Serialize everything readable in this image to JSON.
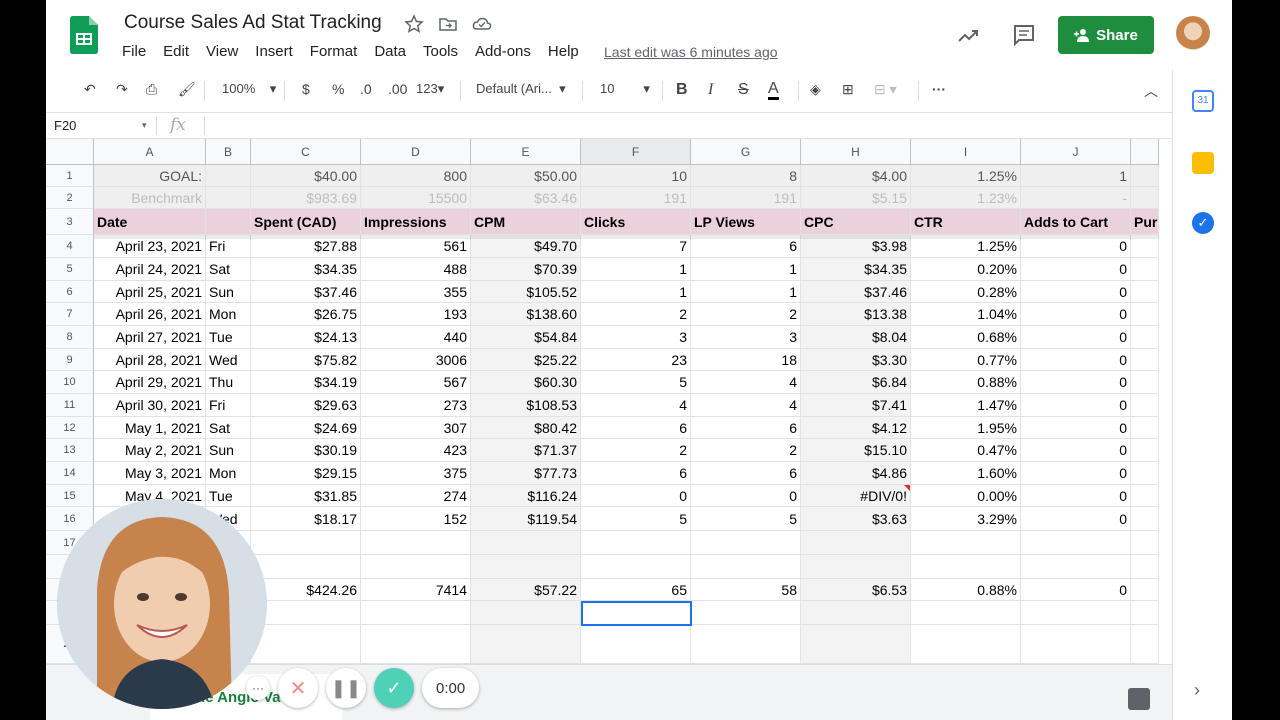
{
  "doc": {
    "title": "Course Sales Ad Stat Tracking",
    "last_edit": "Last edit was 6 minutes ago"
  },
  "menu": [
    "File",
    "Edit",
    "View",
    "Insert",
    "Format",
    "Data",
    "Tools",
    "Add-ons",
    "Help"
  ],
  "share": {
    "label": "Share"
  },
  "toolbar": {
    "zoom": "100%",
    "currency": "$",
    "percent": "%",
    "dec_decrease": ".0",
    "dec_increase": ".00",
    "more_formats": "123",
    "font": "Default (Ari...",
    "font_size": "10",
    "bold": "B",
    "italic": "I",
    "strike": "S",
    "textcolor": "A"
  },
  "formula": {
    "name_box": "F20",
    "fx": "fx"
  },
  "columns": [
    "A",
    "B",
    "C",
    "D",
    "E",
    "F",
    "G",
    "H",
    "I",
    "J"
  ],
  "rows": {
    "r1": [
      "GOAL:",
      "",
      "$40.00",
      "800",
      "$50.00",
      "10",
      "8",
      "$4.00",
      "1.25%",
      "1"
    ],
    "r2": [
      "Benchmark",
      "",
      "$983.69",
      "15500",
      "$63.46",
      "191",
      "191",
      "$5.15",
      "1.23%",
      "-"
    ],
    "r3": [
      "Date",
      "",
      "Spent (CAD)",
      "Impressions",
      "CPM",
      "Clicks",
      "LP Views",
      "CPC",
      "CTR",
      "Adds to Cart",
      "Pur"
    ],
    "data": [
      [
        "April 23, 2021",
        "Fri",
        "$27.88",
        "561",
        "$49.70",
        "7",
        "6",
        "$3.98",
        "1.25%",
        "0"
      ],
      [
        "April 24, 2021",
        "Sat",
        "$34.35",
        "488",
        "$70.39",
        "1",
        "1",
        "$34.35",
        "0.20%",
        "0"
      ],
      [
        "April 25, 2021",
        "Sun",
        "$37.46",
        "355",
        "$105.52",
        "1",
        "1",
        "$37.46",
        "0.28%",
        "0"
      ],
      [
        "April 26, 2021",
        "Mon",
        "$26.75",
        "193",
        "$138.60",
        "2",
        "2",
        "$13.38",
        "1.04%",
        "0"
      ],
      [
        "April 27, 2021",
        "Tue",
        "$24.13",
        "440",
        "$54.84",
        "3",
        "3",
        "$8.04",
        "0.68%",
        "0"
      ],
      [
        "April 28, 2021",
        "Wed",
        "$75.82",
        "3006",
        "$25.22",
        "23",
        "18",
        "$3.30",
        "0.77%",
        "0"
      ],
      [
        "April 29, 2021",
        "Thu",
        "$34.19",
        "567",
        "$60.30",
        "5",
        "4",
        "$6.84",
        "0.88%",
        "0"
      ],
      [
        "April 30, 2021",
        "Fri",
        "$29.63",
        "273",
        "$108.53",
        "4",
        "4",
        "$7.41",
        "1.47%",
        "0"
      ],
      [
        "May 1, 2021",
        "Sat",
        "$24.69",
        "307",
        "$80.42",
        "6",
        "6",
        "$4.12",
        "1.95%",
        "0"
      ],
      [
        "May 2, 2021",
        "Sun",
        "$30.19",
        "423",
        "$71.37",
        "2",
        "2",
        "$15.10",
        "0.47%",
        "0"
      ],
      [
        "May 3, 2021",
        "Mon",
        "$29.15",
        "375",
        "$77.73",
        "6",
        "6",
        "$4.86",
        "1.60%",
        "0"
      ],
      [
        "May 4, 2021",
        "Tue",
        "$31.85",
        "274",
        "$116.24",
        "0",
        "0",
        "#DIV/0!",
        "0.00%",
        "0"
      ],
      [
        "",
        "Wed",
        "$18.17",
        "152",
        "$119.54",
        "5",
        "5",
        "$3.63",
        "3.29%",
        "0"
      ]
    ],
    "totals": [
      "",
      "",
      "$424.26",
      "7414",
      "$57.22",
      "65",
      "58",
      "$6.53",
      "0.88%",
      "0"
    ]
  },
  "row_numbers": [
    "1",
    "2",
    "3",
    "4",
    "5",
    "6",
    "7",
    "8",
    "9",
    "10",
    "11",
    "12",
    "13",
    "14",
    "15",
    "16",
    "17",
    "",
    "",
    "",
    "22"
  ],
  "sheet_tab": {
    "label": "he Angie Va"
  },
  "recorder": {
    "time": "0:00",
    "more": "···",
    "cancel": "✕",
    "pause": "❚❚",
    "done": "✓"
  },
  "colors": {
    "header_pink": "#ead1dc",
    "share_green": "#1e8e3e",
    "selection_blue": "#1a73e8",
    "recorder_teal": "#4fd1b8"
  }
}
